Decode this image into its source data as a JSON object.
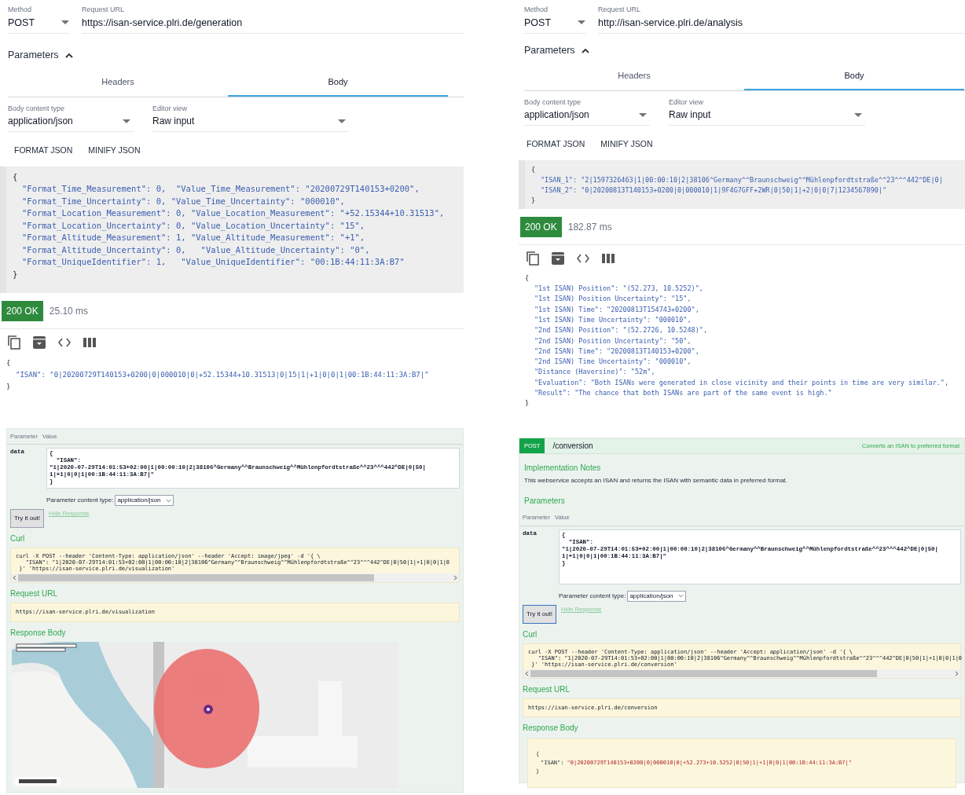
{
  "panels": [
    {
      "kind": "rest_client",
      "method_label": "Method",
      "method": "POST",
      "url_label": "Request URL",
      "url": "https://isan-service.plri.de/generation",
      "parameters": {
        "label": "Parameters",
        "expanded": true
      },
      "tabs": [
        {
          "label": "Headers",
          "selected": false
        },
        {
          "label": "Body",
          "selected": true
        }
      ],
      "content_type_label": "Body content type",
      "content_type": "application/json",
      "editor_view_label": "Editor view",
      "editor_view": "Raw input",
      "buttons": [
        "FORMAT JSON",
        "MINIFY JSON"
      ],
      "request_body": {
        "open": "{",
        "entries": [
          "\"Format_Time_Measurement\": 0,  \"Value_Time_Measurement\": \"20200729T140153+0200\",",
          "\"Format_Time_Uncertainty\": 0, \"Value_Time_Uncertainty\": \"000010\",",
          "\"Format_Location_Measurement\": 0, \"Value_Location_Measurement\": \"+52.15344+10.31513\",",
          "\"Format_Location_Uncertainty\": 0, \"Value_Location_Uncertainty\": \"15\",",
          "\"Format_Altitude_Measurement\": 1, \"Value_Altitude_Measurement\": \"+1\",",
          "\"Format_Altitude_Uncertainty\": 0,   \"Value_Altitude_Uncertainty\": \"0\",",
          "\"Format_UniqueIdentifier\": 1,   \"Value_UniqueIdentifier\": \"00:1B:44:11:3A:B7\""
        ],
        "close": "}"
      },
      "status": "200 OK",
      "time": "25.10 ms",
      "response_body": {
        "open": "{",
        "entries": [
          "\"ISAN\": \"0|20200729T140153+0200|0|000010|0|+52.15344+10.31513|0|15|1|+1|0|0|1|00:1B:44:11:3A:B7|\""
        ],
        "close": "}"
      }
    },
    {
      "kind": "rest_client",
      "method_label": "Method",
      "method": "POST",
      "url_label": "Request URL",
      "url": "http://isan-service.plri.de/analysis",
      "parameters": {
        "label": "Parameters",
        "expanded": true
      },
      "tabs": [
        {
          "label": "Headers",
          "selected": false
        },
        {
          "label": "Body",
          "selected": true
        }
      ],
      "content_type_label": "Body content type",
      "content_type": "application/json",
      "editor_view_label": "Editor view",
      "editor_view": "Raw input",
      "buttons": [
        "FORMAT JSON",
        "MINIFY JSON"
      ],
      "request_body": {
        "open": "{",
        "entries": [
          "\"ISAN_1\": \"2|1597326463|1|00:00:10|2|38106^Germany^^Braunschweig^^Mühlenpfordtstraße^^23^^^442^DE|0|",
          "\"ISAN_2\": \"0|20200813T140153+0200|0|000010|1|9F4G7GFF+2WR|0|50|1|+2|0|0|7|1234567890|\""
        ],
        "close": "}"
      },
      "status": "200 OK",
      "time": "182.87 ms",
      "response_body": {
        "open": "{",
        "entries": [
          "\"1st ISAN) Position\": \"(52.273, 10.5252)\",",
          "\"1st ISAN) Position Uncertainty\": \"15\",",
          "\"1st ISAN) Time\": \"20200813T154743+0200\",",
          "\"1st ISAN) Time Uncertainty\": \"000010\",",
          "\"2nd ISAN) Position\": \"(52.2726, 10.5248)\",",
          "\"2nd ISAN) Position Uncertainty\": \"50\",",
          "\"2nd ISAN) Time\": \"20200813T140153+0200\",",
          "\"2nd ISAN) Time Uncertainty\": \"000010\",",
          "\"Distance (Haversine)\": \"52m\",",
          "\"Evaluation\": \"Both ISANs were generated in close vicinity and their points in time are very similar.\",",
          "\"Result\": \"The chance that both ISANs are part of the same event is high.\""
        ],
        "close": "}"
      }
    },
    {
      "kind": "swagger",
      "columns": [
        "Parameter",
        "Value"
      ],
      "param_name": "data",
      "data_lines": [
        "{",
        "  \"ISAN\":",
        "\"1|2020-07-29T14:01:53+02:00|1|00:00:10|2|38106^Germany^^Braunschweig^^Mühlenpfordtstraße^^23^^^442^DE|0|50|",
        "1|+1|0|0|1|00:1B:44:11:3A:B7|\"",
        "}"
      ],
      "content_type_label": "Parameter content type:",
      "content_type": "application/json",
      "try_button": "Try it out!",
      "hide_link": "Hide Response",
      "curl_heading": "Curl",
      "curl_lines": [
        "curl -X POST --header 'Content-Type: application/json' --header 'Accept: image/jpeg' -d '{ \\",
        "   \"ISAN\": \"1|2020-07-29T14:01:53+02:00|1|00:00:10|2|38106^Germany^^Braunschweig^^Mühlenpfordtstraße^^23^^^442^DE|0|50|1|+1|0|0|1|0",
        " }' 'https://isan-service.plri.de/visualization'"
      ],
      "request_url_heading": "Request URL",
      "request_url": "https://isan-service.plri.de/visualization",
      "response_heading": "Response Body",
      "response": {
        "kind": "map"
      }
    },
    {
      "kind": "swagger",
      "operation": {
        "method": "POST",
        "path": "/conversion",
        "summary": "Converts an ISAN to preferred format"
      },
      "notes_heading": "Implementation Notes",
      "notes": "This webservice accepts an ISAN and returns the ISAN with semantic data in preferred format.",
      "parameters_heading": "Parameters",
      "columns": [
        "Parameter",
        "Value"
      ],
      "param_name": "data",
      "data_lines": [
        "{",
        "  \"ISAN\":",
        "\"1|2020-07-29T14:01:53+02:00|1|00:00:10|2|38106^Germany^^Braunschweig^^Mühlenpfordtstraße^^23^^^442^DE|0|50|",
        "1|+1|0|0|1|00:1B:44:11:3A:B7|\"",
        "}"
      ],
      "content_type_label": "Parameter content type:",
      "content_type": "application/json",
      "try_button": "Try it out!",
      "hide_link": "Hide Response",
      "curl_heading": "Curl",
      "curl_lines": [
        "curl -X POST --header 'Content-Type: application/json' --header 'Accept: application/json' -d '{ \\",
        "   \"ISAN\": \"1|2020-07-29T14:01:53+02:00|1|00:00:10|2|38106^Germany^^Braunschweig^^Mühlenpfordtstraße^^23^^^442^DE|0|50|1|+1|0|0|1|0",
        " }' 'https://isan-service.plri.de/conversion'"
      ],
      "request_url_heading": "Request URL",
      "request_url": "https://isan-service.plri.de/conversion",
      "response_heading": "Response Body",
      "response": {
        "kind": "code",
        "open": "{",
        "entries": [
          {
            "key": "\"ISAN\":",
            "value": "\"0|20200729T140153+0200|0|000010|0|+52.273+10.5252|0|50|1|+1|0|0|1|00:1B:44:11:3A:B7|\""
          }
        ],
        "close": "}"
      }
    }
  ]
}
